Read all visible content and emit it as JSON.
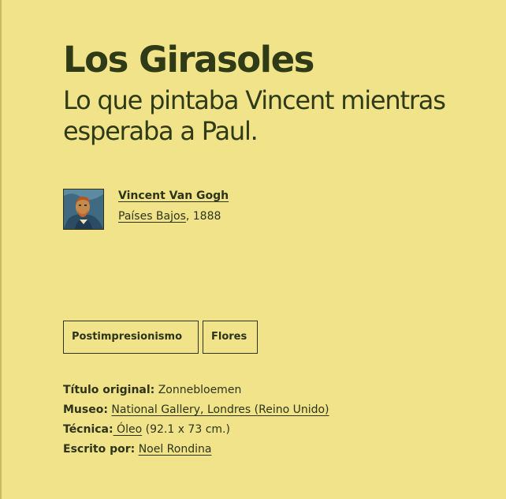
{
  "artwork": {
    "title": "Los Girasoles",
    "subtitle": "Lo que pintaba Vincent mientras esperaba a Paul."
  },
  "author": {
    "name": "Vincent Van Gogh",
    "country": "Países Bajos",
    "year_text": ", 1888",
    "avatar_icon": "self-portrait-thumbnail"
  },
  "tags": [
    "Postimpresionismo",
    "Flores"
  ],
  "details": {
    "original_title_label": "Título original:",
    "original_title_value": " Zonnebloemen",
    "museum_label": "Museo:",
    "museum_value": "National Gallery, Londres (Reino Unido)",
    "technique_label": "Técnica:",
    "technique_value": " Óleo",
    "dimensions": " (92.1 x 73 cm.)",
    "writer_label": "Escrito por:",
    "writer_value": "Noel Rondina"
  },
  "colors": {
    "background": "#f0e38a",
    "text": "#2d3419"
  }
}
